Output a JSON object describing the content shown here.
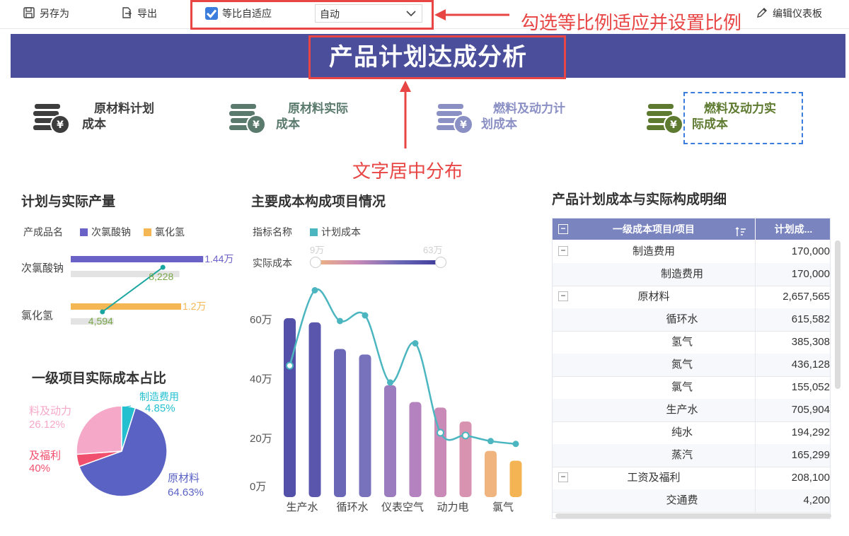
{
  "toolbar": {
    "save_as": "另存为",
    "export": "导出",
    "auto_fit_label": "等比自适应",
    "ratio_value": "自动",
    "edit_dashboard": "编辑仪表板"
  },
  "annotations": {
    "check_ratio": "勾选等比例适应并设置比例",
    "text_center": "文字居中分布"
  },
  "banner": {
    "title": "产品计划达成分析"
  },
  "kpis": [
    {
      "line1": "原材料计划",
      "line2": "成本",
      "color": "#3d3d3d"
    },
    {
      "line1": "原材料实际",
      "line2": "成本",
      "color": "#5a7a6e"
    },
    {
      "line1": "燃料及动力计",
      "line2": "划成本",
      "color": "#8a8fc4"
    },
    {
      "line1": "燃料及动力实",
      "line2": "际成本",
      "color": "#5e7a30"
    }
  ],
  "output_chart": {
    "title": "计划与实际产量",
    "legend_title": "产成品名",
    "legend": [
      {
        "name": "次氯酸钠",
        "color": "#6b62c7"
      },
      {
        "name": "氯化氢",
        "color": "#f5b754"
      }
    ],
    "chart_data": {
      "type": "bar",
      "categories": [
        "次氯酸钠",
        "氯化氢"
      ],
      "series": [
        {
          "name": "次氯酸钠",
          "values": [
            14400
          ]
        },
        {
          "name": "氯化氢",
          "values": [
            12000
          ]
        }
      ],
      "plan_labels": [
        "1.44万",
        "1.2万"
      ],
      "actual_labels": [
        "8,228",
        "4,594"
      ],
      "actual_values": [
        8228,
        4594
      ]
    }
  },
  "pie_chart": {
    "title": "一级项目实际成本占比",
    "chart_data": {
      "type": "pie",
      "slices": [
        {
          "name": "原材料",
          "value": 64.63,
          "label": "64.63%",
          "color": "#5a62c4"
        },
        {
          "name": "工资及福利",
          "value": 4.4,
          "label": "40%",
          "label_name": "及福利",
          "color": "#f0506e"
        },
        {
          "name": "燃料及动力",
          "value": 26.12,
          "label": "26.12%",
          "label_name": "料及动力",
          "color": "#f6a8c8"
        },
        {
          "name": "制造费用",
          "value": 4.85,
          "label": "4.85%",
          "label_name": "制造费用",
          "color": "#25c0d0"
        }
      ]
    }
  },
  "cost_chart": {
    "title": "主要成本构成项目情况",
    "legend_title": "指标名称",
    "legend_item": "计划成本",
    "slider_label": "实际成本",
    "slider_min": "9万",
    "slider_max": "63万",
    "chart_data": {
      "type": "bar",
      "categories": [
        "生产水",
        "",
        "循环水",
        "",
        "仪表空气",
        "",
        "动力电",
        "",
        "氯气",
        ""
      ],
      "x_labels": [
        "生产水",
        "循环水",
        "仪表空气",
        "动力电",
        "氯气"
      ],
      "y_ticks": [
        "0万",
        "20万",
        "40万",
        "60万"
      ],
      "ylim": [
        0,
        60
      ],
      "bar_values": [
        60,
        58.5,
        49,
        47,
        36,
        30,
        28,
        23,
        12.5,
        9
      ],
      "line_values": [
        43,
        70,
        59,
        61,
        37,
        51,
        19,
        18,
        16,
        15
      ],
      "bar_colors": [
        "#5250a8",
        "#5a56ae",
        "#6a68b6",
        "#7772bb",
        "#9b7cbe",
        "#b482bf",
        "#c98ab8",
        "#d893b0",
        "#f0b47e",
        "#f5b454"
      ],
      "line_color": "#4cb6c0"
    }
  },
  "table": {
    "title": "产品计划成本与实际构成明细",
    "col1": "一级成本项目/项目",
    "col2": "计划成...",
    "rows": [
      {
        "name": "制造费用",
        "value": "170,000",
        "level": 1
      },
      {
        "name": "制造费用",
        "value": "170,000",
        "level": 2
      },
      {
        "name": "原材料",
        "value": "2,657,565",
        "level": 1
      },
      {
        "name": "循环水",
        "value": "615,582",
        "level": 2
      },
      {
        "name": "氢气",
        "value": "385,308",
        "level": 2
      },
      {
        "name": "氮气",
        "value": "436,128",
        "level": 2
      },
      {
        "name": "氯气",
        "value": "155,052",
        "level": 2
      },
      {
        "name": "生产水",
        "value": "705,904",
        "level": 2
      },
      {
        "name": "纯水",
        "value": "194,292",
        "level": 2
      },
      {
        "name": "蒸汽",
        "value": "165,299",
        "level": 2
      },
      {
        "name": "工资及福利",
        "value": "208,100",
        "level": 1
      },
      {
        "name": "交通费",
        "value": "4,200",
        "level": 2
      }
    ]
  }
}
